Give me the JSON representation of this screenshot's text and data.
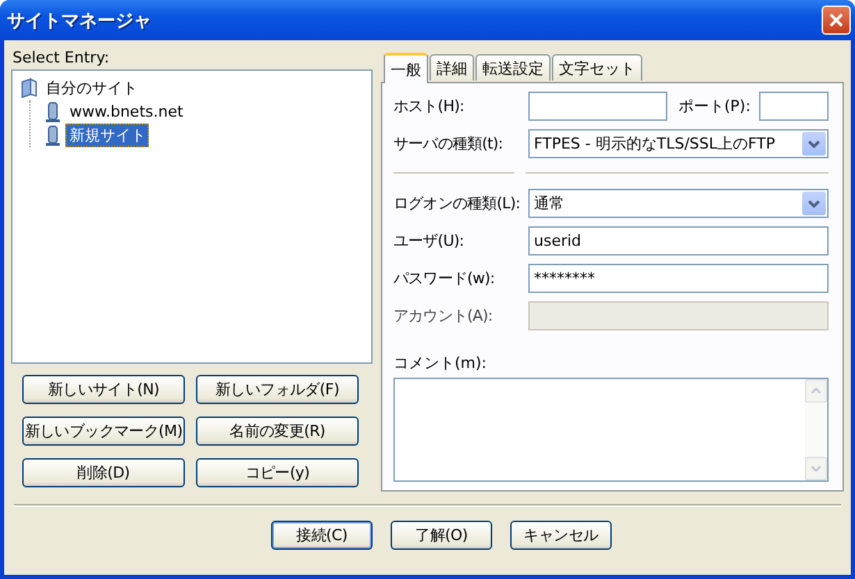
{
  "window": {
    "title": "サイトマネージャ"
  },
  "select_entry_label": "Select Entry:",
  "tree": [
    {
      "label": "自分のサイト",
      "kind": "folder",
      "selected": false,
      "children": [
        {
          "label": "www.bnets.net",
          "kind": "server",
          "selected": false
        },
        {
          "label": "新規サイト",
          "kind": "server",
          "selected": true
        }
      ]
    }
  ],
  "left_buttons": [
    "新しいサイト(N)",
    "新しいフォルダ(F)",
    "新しいブックマーク(M)",
    "名前の変更(R)",
    "削除(D)",
    "コピー(y)"
  ],
  "tabs": [
    {
      "label": "一般",
      "selected": true
    },
    {
      "label": "詳細",
      "selected": false
    },
    {
      "label": "転送設定",
      "selected": false
    },
    {
      "label": "文字セット",
      "selected": false
    }
  ],
  "general": {
    "host": {
      "label": "ホスト(H):"
    },
    "port": {
      "label": "ポート(P):"
    },
    "server_type": {
      "label": "サーバの種類(t):",
      "value": "FTPES - 明示的なTLS/SSL上のFTP"
    },
    "logon_type": {
      "label": "ログオンの種類(L):",
      "value": "通常"
    },
    "user": {
      "label": "ユーザ(U):",
      "value": "userid"
    },
    "password": {
      "label": "パスワード(w):",
      "value": "********"
    },
    "account": {
      "label": "アカウント(A):",
      "disabled": true
    },
    "comment": {
      "label": "コメント(m):"
    }
  },
  "bottom_buttons": [
    {
      "label": "接続(C)",
      "default": true
    },
    {
      "label": "了解(O)",
      "default": false
    },
    {
      "label": "キャンセル",
      "default": false
    }
  ]
}
